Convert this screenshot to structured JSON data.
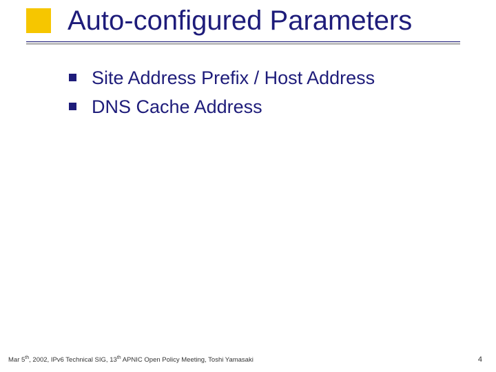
{
  "title": "Auto-configured Parameters",
  "bullets": [
    "Site Address Prefix / Host Address",
    "DNS Cache Address"
  ],
  "footer": {
    "pre": "Mar 5",
    "sup1": "th",
    "mid": ", 2002, IPv6 Technical SIG, 13",
    "sup2": "th",
    "post": " APNIC Open Policy Meeting, Toshi Yamasaki"
  },
  "slide_number": "4",
  "colors": {
    "accent_yellow": "#f6c600",
    "brand_navy": "#1e1c7a"
  }
}
